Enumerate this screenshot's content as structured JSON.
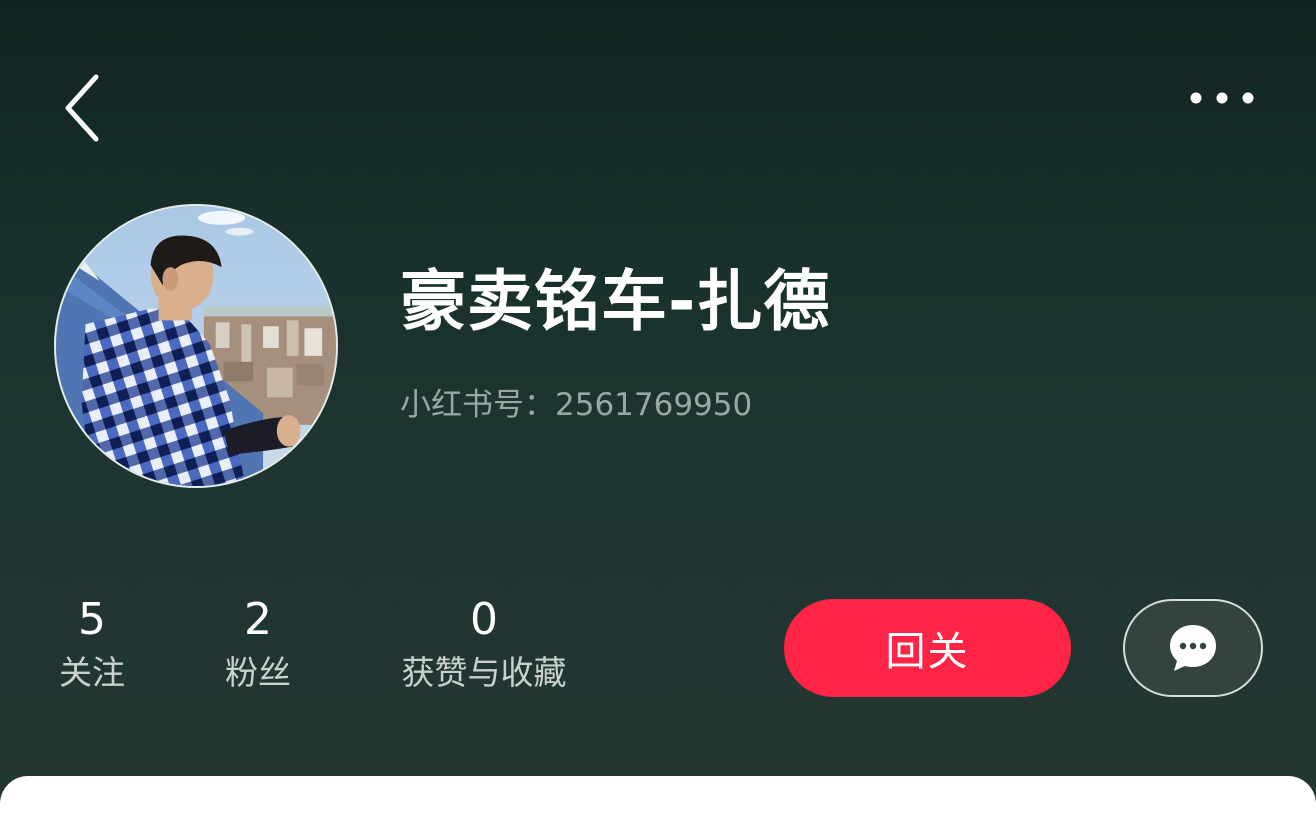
{
  "header": {
    "back_icon": "chevron-left-icon",
    "more_icon": "more-horizontal-icon"
  },
  "profile": {
    "avatar_icon": "avatar-photo",
    "nickname": "豪卖铭车-扎德",
    "redid_text": "小红书号：2561769950"
  },
  "stats": [
    {
      "value": "5",
      "label": "关注"
    },
    {
      "value": "2",
      "label": "粉丝"
    },
    {
      "value": "0",
      "label": "获赞与收藏"
    }
  ],
  "actions": {
    "follow_back_label": "回关",
    "message_icon": "chat-bubble-icon"
  },
  "colors": {
    "accent": "#fd2446",
    "background_top": "#112421",
    "background_bottom": "#233632"
  }
}
